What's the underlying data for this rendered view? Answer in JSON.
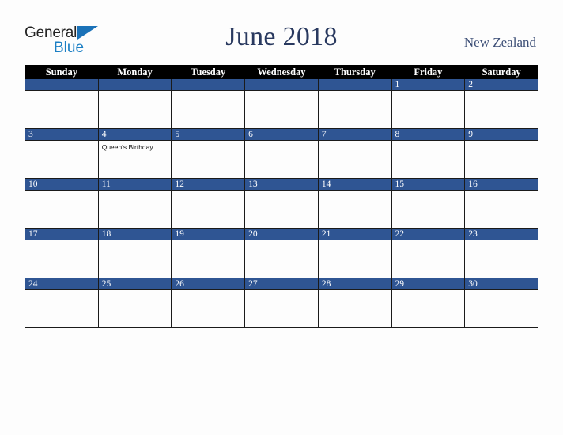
{
  "logo": {
    "word_one": "General",
    "word_two": "Blue",
    "triangle_color": "#1b72b8",
    "word_two_color": "#1b7fc4"
  },
  "header": {
    "title": "June 2018",
    "country": "New Zealand",
    "title_color": "#29395f"
  },
  "calendar": {
    "weekday_headers": [
      "Sunday",
      "Monday",
      "Tuesday",
      "Wednesday",
      "Thursday",
      "Friday",
      "Saturday"
    ],
    "header_bg": "#000000",
    "daynum_band_color": "#2f5593",
    "weeks": [
      [
        {
          "day": "",
          "event": ""
        },
        {
          "day": "",
          "event": ""
        },
        {
          "day": "",
          "event": ""
        },
        {
          "day": "",
          "event": ""
        },
        {
          "day": "",
          "event": ""
        },
        {
          "day": "1",
          "event": ""
        },
        {
          "day": "2",
          "event": ""
        }
      ],
      [
        {
          "day": "3",
          "event": ""
        },
        {
          "day": "4",
          "event": "Queen's Birthday"
        },
        {
          "day": "5",
          "event": ""
        },
        {
          "day": "6",
          "event": ""
        },
        {
          "day": "7",
          "event": ""
        },
        {
          "day": "8",
          "event": ""
        },
        {
          "day": "9",
          "event": ""
        }
      ],
      [
        {
          "day": "10",
          "event": ""
        },
        {
          "day": "11",
          "event": ""
        },
        {
          "day": "12",
          "event": ""
        },
        {
          "day": "13",
          "event": ""
        },
        {
          "day": "14",
          "event": ""
        },
        {
          "day": "15",
          "event": ""
        },
        {
          "day": "16",
          "event": ""
        }
      ],
      [
        {
          "day": "17",
          "event": ""
        },
        {
          "day": "18",
          "event": ""
        },
        {
          "day": "19",
          "event": ""
        },
        {
          "day": "20",
          "event": ""
        },
        {
          "day": "21",
          "event": ""
        },
        {
          "day": "22",
          "event": ""
        },
        {
          "day": "23",
          "event": ""
        }
      ],
      [
        {
          "day": "24",
          "event": ""
        },
        {
          "day": "25",
          "event": ""
        },
        {
          "day": "26",
          "event": ""
        },
        {
          "day": "27",
          "event": ""
        },
        {
          "day": "28",
          "event": ""
        },
        {
          "day": "29",
          "event": ""
        },
        {
          "day": "30",
          "event": ""
        }
      ]
    ]
  }
}
